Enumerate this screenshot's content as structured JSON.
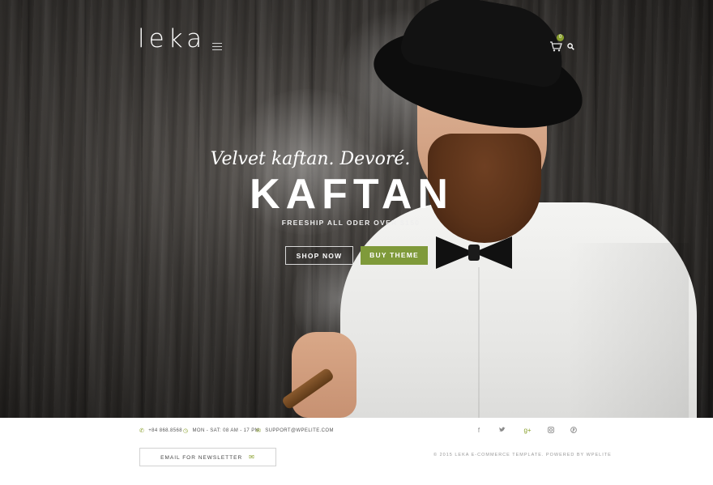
{
  "header": {
    "logo": "leka",
    "cart_count": "0"
  },
  "hero": {
    "tagline": "Velvet kaftan. Devoré.",
    "headline": "KAFTAN",
    "subline": "FREESHIP ALL ODER OVER $150",
    "shop_label": "SHOP NOW",
    "buy_label": "BUY THEME"
  },
  "footer": {
    "phone": "+84 868.8568",
    "hours": "MON - SAT: 08 AM - 17 PM",
    "email": "SUPPORT@WPELITE.COM",
    "newsletter_label": "EMAIL FOR NEWSLETTER",
    "copyright": "© 2015 LEKA E-COMMERCE TEMPLATE. POWERED BY WPELITE",
    "social": [
      "f",
      "t",
      "g+",
      "ig",
      "p"
    ]
  },
  "colors": {
    "accent": "#7f9a3a",
    "background_dark": "#2a2826"
  }
}
